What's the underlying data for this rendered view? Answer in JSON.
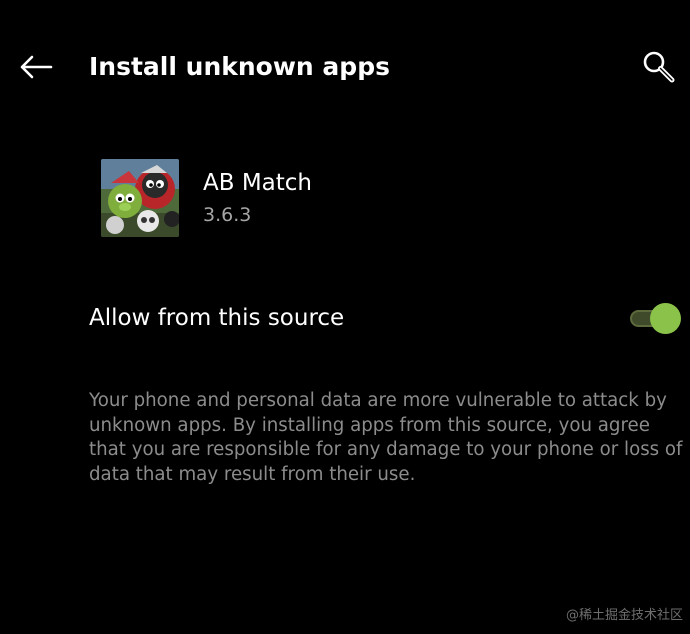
{
  "header": {
    "title": "Install unknown apps",
    "back_icon": "arrow-left-icon",
    "search_icon": "search-icon"
  },
  "app": {
    "name": "AB Match",
    "version": "3.6.3",
    "icon": "ab-match-app-icon"
  },
  "allow": {
    "label": "Allow from this source",
    "enabled": true,
    "accent_color": "#8bc34a"
  },
  "warning": {
    "text": "Your phone and personal data are more vulnerable to attack by unknown apps. By installing apps from this source, you agree that you are responsible for any damage to your phone or loss of data that may result from their use."
  },
  "watermark": {
    "text": "@稀土掘金技术社区"
  },
  "colors": {
    "background": "#000000",
    "primary_text": "#ffffff",
    "secondary_text": "#a6a6a6",
    "body_text": "#8c8c8c"
  }
}
